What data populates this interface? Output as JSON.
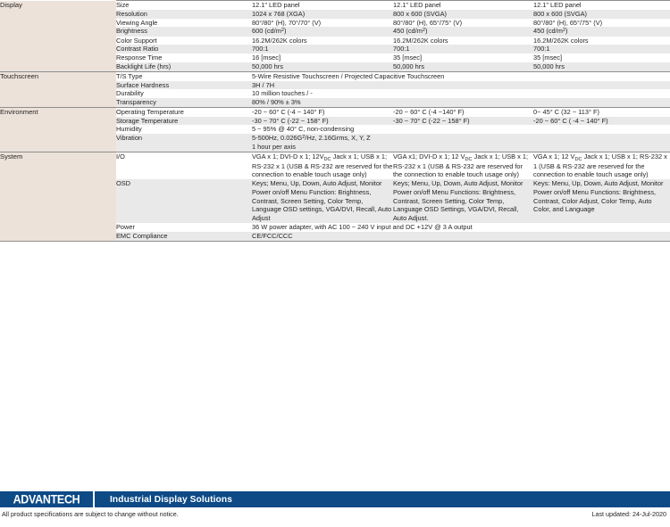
{
  "document": {
    "type": "product-specification-table",
    "brand": "ADVANTECH",
    "tagline": "Industrial Display Solutions",
    "disclaimer": "All product specifications are subject to change without notice.",
    "last_updated_label": "Last updated: 24-Jul-2020",
    "colors": {
      "brand_blue": "#0d4a86",
      "category_beige": "#ece2d9",
      "row_stripe": "#e9e9e9",
      "rule": "#8e8e8e",
      "text": "#231f20"
    }
  },
  "sections": [
    {
      "category": "Display",
      "rows": [
        {
          "name": "Size",
          "merged": false,
          "values": [
            "12.1\" LED panel",
            "12.1\" LED panel",
            "12.1\" LED panel"
          ]
        },
        {
          "name": "Resolution",
          "merged": false,
          "values": [
            "1024 x 768 (XGA)",
            "800 x 600 (SVGA)",
            "800 x 600 (SVGA)"
          ]
        },
        {
          "name": "Viewing Angle",
          "merged": false,
          "values": [
            "80°/80° (H), 70°/70° (V)",
            "80°/80° (H), 65°/75° (V)",
            "80°/80° (H), 65°/75° (V)"
          ]
        },
        {
          "name": "Brightness",
          "merged": false,
          "values": [
            "600 (cd/m²)",
            "450 (cd/m²)",
            "450 (cd/m²)"
          ]
        },
        {
          "name": "Color Support",
          "merged": false,
          "values": [
            "16.2M/262K colors",
            "16.2M/262K colors",
            "16.2M/262K colors"
          ]
        },
        {
          "name": "Contrast Ratio",
          "merged": false,
          "values": [
            "700:1",
            "700:1",
            "700:1"
          ]
        },
        {
          "name": "Response Time",
          "merged": false,
          "values": [
            "16 [msec]",
            "35 [msec]",
            "35 [msec]"
          ]
        },
        {
          "name": "Backlight Life (hrs)",
          "merged": false,
          "values": [
            "50,000 hrs",
            "50,000 hrs",
            "50,000 hrs"
          ]
        }
      ]
    },
    {
      "category": "Touchscreen",
      "rows": [
        {
          "name": "T/S Type",
          "merged": true,
          "values": [
            "5-Wire Resistive Touchscreen / Projected Capacitive Touchscreen"
          ]
        },
        {
          "name": "Surface Hardness",
          "merged": true,
          "values": [
            "3H / 7H"
          ]
        },
        {
          "name": "Durability",
          "merged": true,
          "values": [
            "10 million touches / -"
          ]
        },
        {
          "name": "Transparency",
          "merged": true,
          "values": [
            "80% / 90% ± 3%"
          ]
        }
      ]
    },
    {
      "category": "Environment",
      "rows": [
        {
          "name": "Operating Temperature",
          "merged": false,
          "values": [
            "-20 ~ 60° C (-4 ~ 140° F)",
            "-20 ~ 60° C (-4 ~140° F)",
            "0~ 45° C (32 ~ 113° F)"
          ]
        },
        {
          "name": "Storage Temperature",
          "merged": false,
          "values": [
            "-30 ~ 70° C (-22 ~ 158° F)",
            "-30 ~ 70° C (-22 ~ 158° F)",
            "-20 ~ 60° C ( -4 ~ 140° F)"
          ]
        },
        {
          "name": "Humidity",
          "merged": true,
          "values": [
            "5 ~ 95% @ 40° C, non-condensing"
          ]
        },
        {
          "name": "Vibration",
          "merged": true,
          "values": [
            "5-500Hz, 0.026G²/Hz, 2.16Grms, X, Y, Z\n1 hour per axis"
          ]
        }
      ]
    },
    {
      "category": "System",
      "rows": [
        {
          "name": "I/O",
          "merged": false,
          "values": [
            "VGA x 1; DVI-D x 1; 12VDC Jack x 1; USB x 1; RS-232 x 1 (USB & RS-232 are reserved for the connection to enable touch usage only)",
            "VGA x1; DVI-D x 1; 12 VDC Jack x 1; USB x 1; RS-232 x 1 (USB & RS-232 are reserved for the connection to enable touch usage only)",
            "VGA x 1; 12 VDC Jack x 1; USB x 1; RS-232 x 1   (USB & RS-232 are reserved for the connection to enable  touch usage only)"
          ]
        },
        {
          "name": "OSD",
          "merged": false,
          "values": [
            "Keys; Menu, Up, Down, Auto Adjust, Monitor Power on/off Menu Function: Brightness, Contrast, Screen Setting, Color Temp, Language OSD settings, VGA/DVI, Recall, Auto Adjust",
            "Keys; Menu, Up, Down, Auto Adjust, Monitor Power on/off Menu Functions: Brightness, Contrast, Screen Setting, Color Temp, Language OSD Settings, VGA/DVI, Recall, Auto Adjust.",
            "Keys: Menu, Up, Down, Auto Adjust, Monitor Power on/off Menu Functions: Brightness, Contrast, Color Adjust,  Color Temp, Auto Color, and Language"
          ]
        },
        {
          "name": "Power",
          "merged": true,
          "values": [
            "36 W power adapter, with AC 100 ~ 240 V input and DC +12V @ 3 A output"
          ]
        },
        {
          "name": "EMC Compliance",
          "merged": true,
          "values": [
            "CE/FCC/CCC"
          ]
        }
      ]
    }
  ]
}
